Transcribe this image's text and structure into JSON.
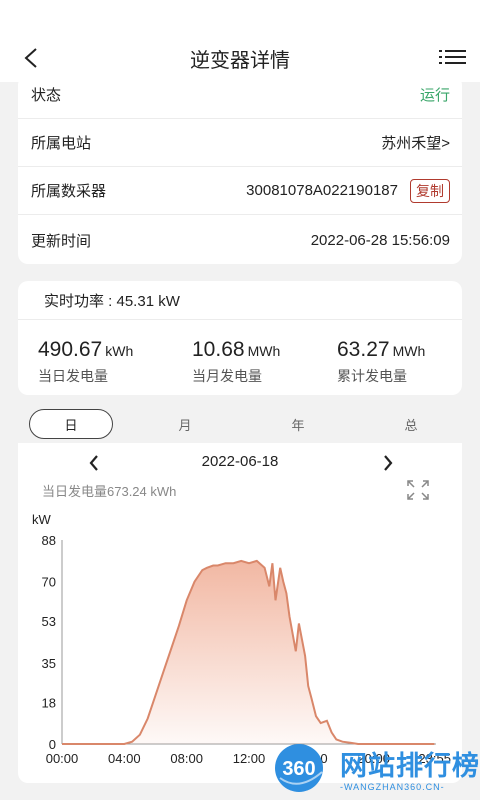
{
  "header": {
    "title": "逆变器详情"
  },
  "info": {
    "rows": [
      {
        "label": "状态",
        "value": "运行"
      },
      {
        "label": "所属电站",
        "value": "苏州禾望>"
      },
      {
        "label": "所属数采器",
        "value": "30081078A022190187",
        "action": "复制"
      },
      {
        "label": "更新时间",
        "value": "2022-06-28 15:56:09"
      }
    ],
    "status_color": "#3aa66a"
  },
  "power": {
    "realtime_label": "实时功率 : 45.31 kW",
    "stats": [
      {
        "value": "490.67",
        "unit": "kWh",
        "caption": "当日发电量"
      },
      {
        "value": "10.68",
        "unit": "MWh",
        "caption": "当月发电量"
      },
      {
        "value": "63.27",
        "unit": "MWh",
        "caption": "累计发电量"
      }
    ]
  },
  "tabs": [
    "日",
    "月",
    "年",
    "总"
  ],
  "chart_panel": {
    "date": "2022-06-18",
    "day_total": "当日发电量673.24 kWh"
  },
  "chart_data": {
    "type": "area",
    "ylabel": "kW",
    "ylim": [
      0,
      88
    ],
    "yticks": [
      "0",
      "18",
      "35",
      "53",
      "70",
      "88"
    ],
    "xticks": [
      "00:00",
      "04:00",
      "08:00",
      "12:00",
      "16:00",
      "20:00",
      "23:55"
    ],
    "x_hours": [
      0,
      4,
      4.5,
      5,
      5.5,
      6,
      6.5,
      7,
      7.5,
      8,
      8.5,
      9,
      9.3,
      9.7,
      10,
      10.5,
      11,
      11.5,
      12,
      12.5,
      13,
      13.3,
      13.5,
      13.7,
      14,
      14.2,
      14.4,
      14.6,
      15,
      15.2,
      15.4,
      15.6,
      15.8,
      16,
      16.3,
      16.6,
      17,
      17.3,
      17.6,
      18,
      18.5,
      19,
      20,
      23.9
    ],
    "values": [
      0,
      0,
      1,
      4,
      11,
      21,
      31,
      41,
      51,
      62,
      70,
      75,
      76,
      77,
      77,
      78,
      78,
      79,
      78,
      79,
      76,
      68,
      78,
      62,
      76,
      70,
      65,
      55,
      40,
      52,
      45,
      38,
      25,
      20,
      12,
      9,
      10,
      5,
      2,
      1,
      0.5,
      0,
      0,
      0
    ],
    "line_color": "#d9876a",
    "fill_color": "#f1b49e"
  },
  "watermark": {
    "text": "网站排行榜",
    "sub": "-WANGZHAN360.CN-",
    "badge": "360"
  }
}
